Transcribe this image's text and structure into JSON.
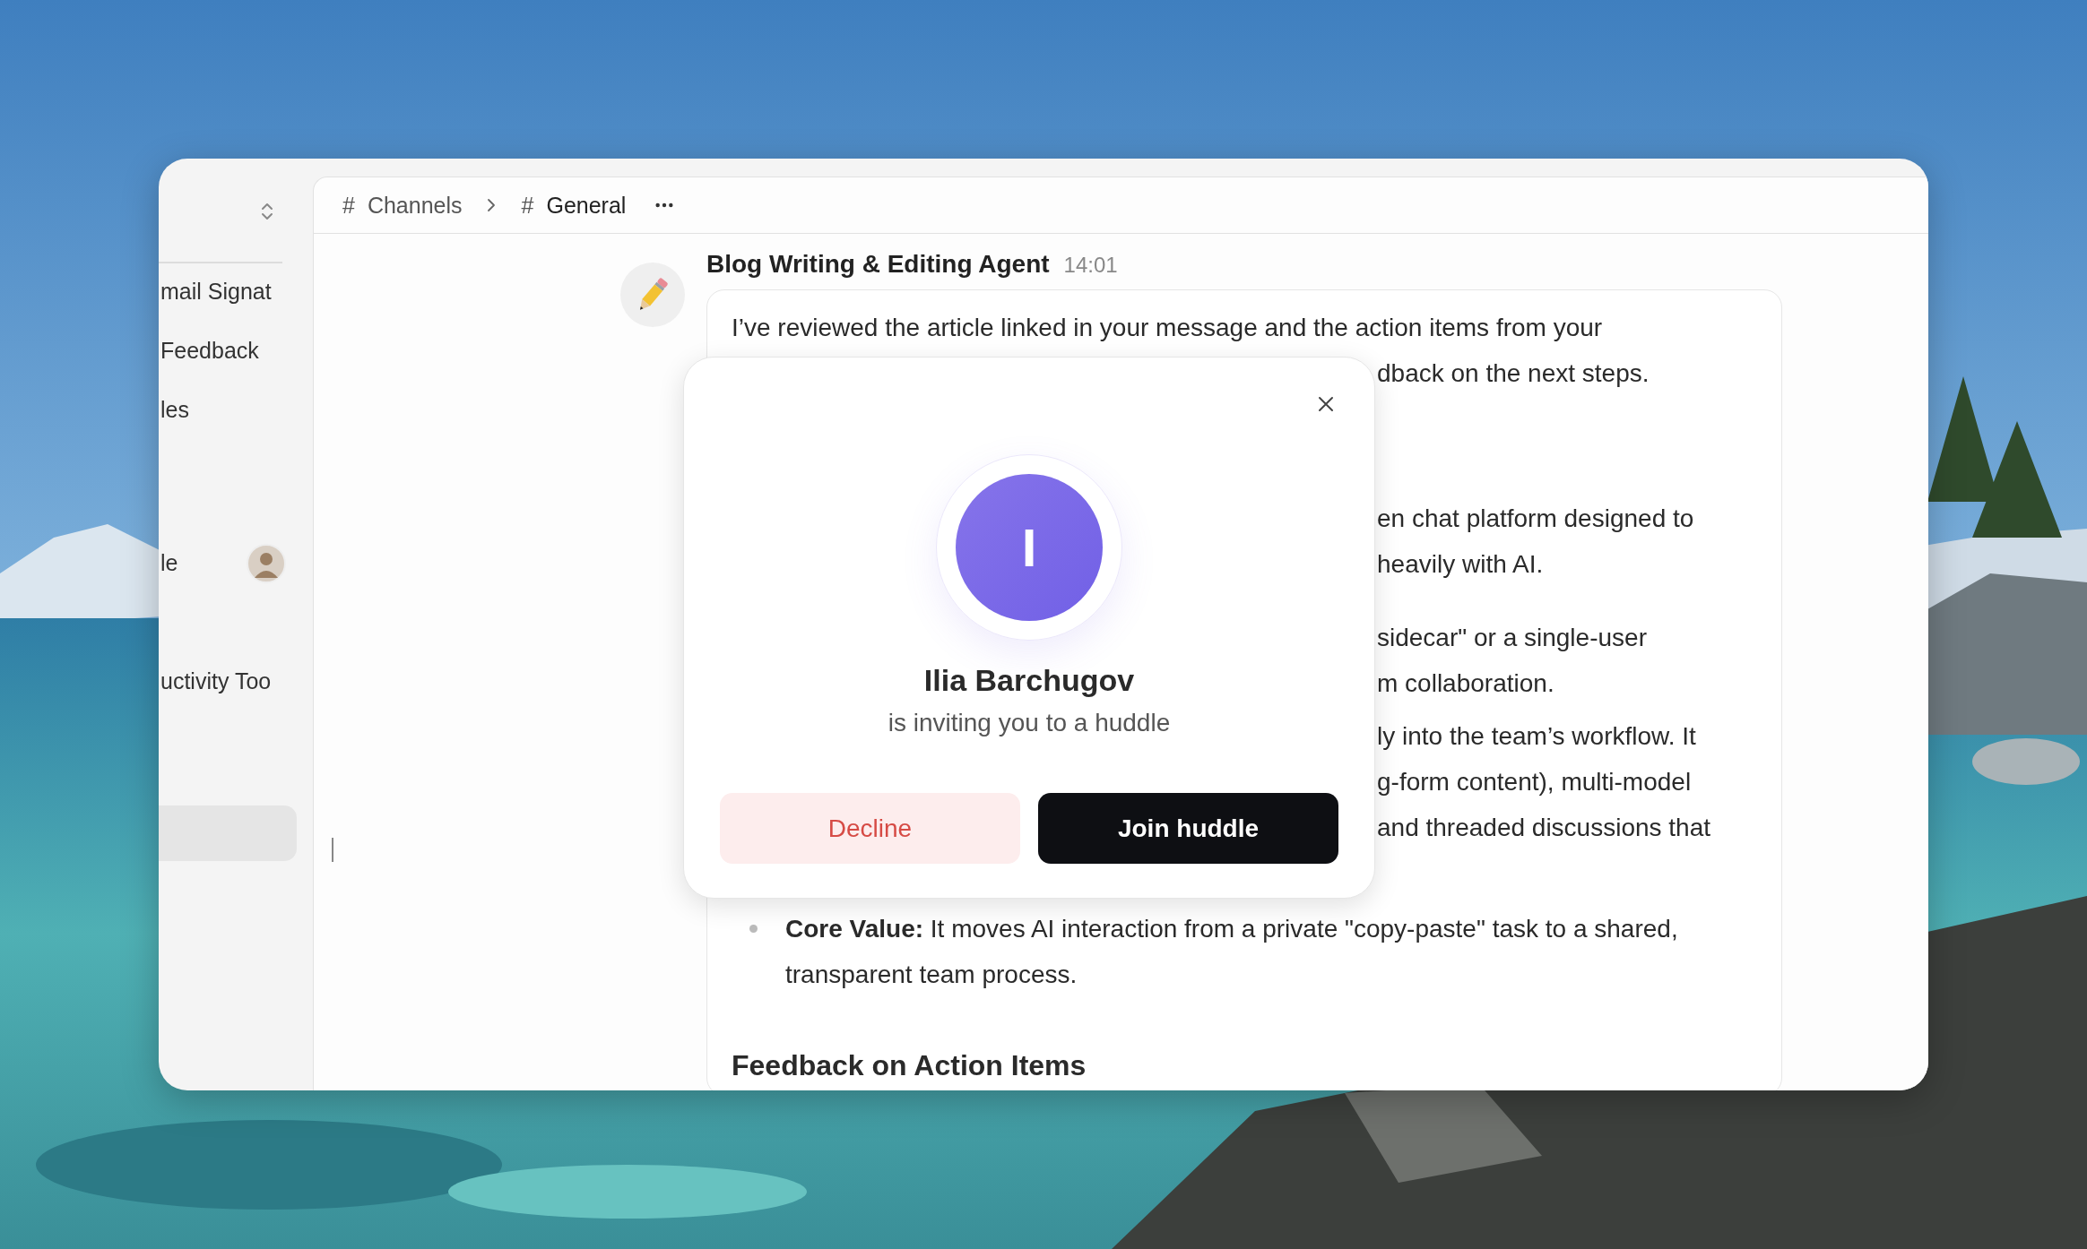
{
  "sidebar": {
    "items": [
      {
        "label": "mail Signat",
        "kind": "text",
        "selected": false
      },
      {
        "label": "Feedback",
        "kind": "text",
        "selected": false
      },
      {
        "label": "les",
        "kind": "text",
        "selected": false
      },
      {
        "label": "le",
        "kind": "person",
        "selected": false
      },
      {
        "label": "uctivity Too",
        "kind": "text",
        "selected": false
      },
      {
        "kind": "blank",
        "selected": true
      }
    ]
  },
  "breadcrumb": [
    {
      "hash": "#",
      "label": "Channels"
    },
    {
      "hash": "#",
      "label": "General"
    }
  ],
  "message": {
    "author": "Blog Writing & Editing Agent",
    "time": "14:01",
    "paragraphs": [
      {
        "lines": [
          {
            "kind": "line",
            "text": "I’ve reviewed the article linked in your message and the action items from your"
          },
          {
            "kind": "fragment",
            "text": "dback on the next steps."
          }
        ]
      },
      {
        "lines": [
          {
            "kind": "fragment",
            "text": "en chat platform designed to"
          },
          {
            "kind": "fragment",
            "text": "heavily with AI."
          }
        ]
      },
      {
        "lines": [
          {
            "kind": "fragment",
            "text": "sidecar\" or a single-user"
          },
          {
            "kind": "fragment",
            "text": "m collaboration."
          }
        ]
      },
      {
        "lines": [
          {
            "kind": "fragment",
            "text": "ly into the team’s workflow. It"
          },
          {
            "kind": "fragment",
            "text": "g-form content), multi-model"
          },
          {
            "kind": "fragment",
            "text": "and threaded discussions that"
          }
        ]
      },
      {
        "lines": [
          {
            "kind": "bullet",
            "text": "**Core Value:** It moves AI interaction from a private \"copy-paste\" task to a shared, transparent team process."
          }
        ]
      },
      {
        "lines": [
          {
            "kind": "heading",
            "text": "Feedback on Action Items"
          }
        ]
      }
    ]
  },
  "huddle_dialog": {
    "initial": "I",
    "name": "Ilia Barchugov",
    "subtitle": "is inviting you to a huddle",
    "buttons": [
      {
        "label": "Decline",
        "kind": "decline"
      },
      {
        "label": "Join huddle",
        "kind": "join"
      }
    ]
  }
}
